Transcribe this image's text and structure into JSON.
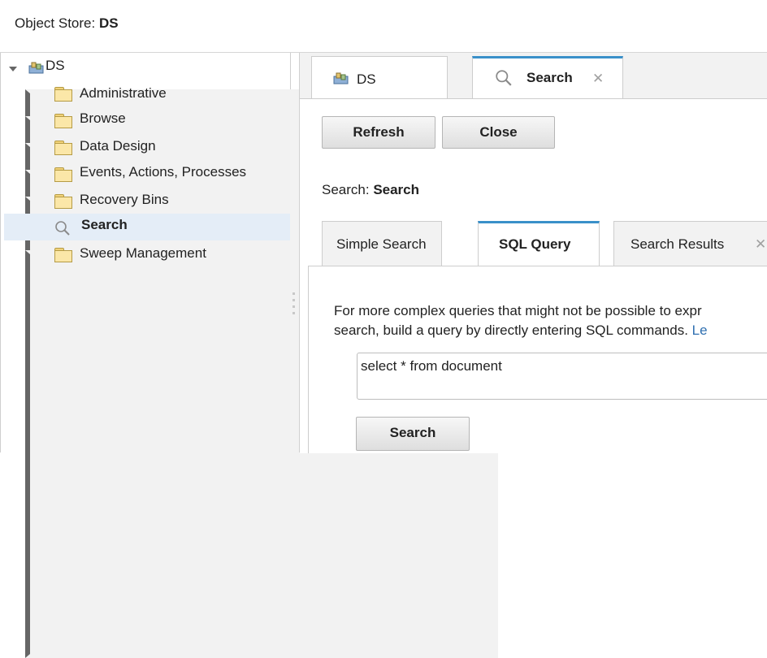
{
  "header": {
    "prefix": "Object Store: ",
    "store_name": "DS"
  },
  "tree": {
    "root_label": "DS",
    "items": [
      {
        "label": "Administrative",
        "icon": "folder-icon"
      },
      {
        "label": "Browse",
        "icon": "folder-icon"
      },
      {
        "label": "Data Design",
        "icon": "folder-icon"
      },
      {
        "label": "Events, Actions, Processes",
        "icon": "folder-icon"
      },
      {
        "label": "Recovery Bins",
        "icon": "folder-icon"
      },
      {
        "label": "Search",
        "icon": "search-icon",
        "selected": true
      },
      {
        "label": "Sweep Management",
        "icon": "folder-icon"
      }
    ]
  },
  "outer_tabs": [
    {
      "label": "DS",
      "icon": "object-store-icon"
    },
    {
      "label": "Search",
      "icon": "search-icon",
      "active": true,
      "closable": true
    }
  ],
  "toolbar": {
    "refresh_label": "Refresh",
    "close_label": "Close"
  },
  "search_title": {
    "prefix": "Search: ",
    "name": "Search"
  },
  "inner_tabs": [
    {
      "label": "Simple Search"
    },
    {
      "label": "SQL Query",
      "active": true
    },
    {
      "label": "Search Results",
      "closable": true
    }
  ],
  "sql": {
    "description_line1": "For more complex queries that might not be possible to expr",
    "description_line2": "search, build a query by directly entering SQL commands. ",
    "link_text": "Le",
    "query_value": "select * from document",
    "search_button": "Search"
  },
  "colors": {
    "accent": "#3a90c9",
    "selection": "#e4edf7",
    "link": "#2f6fb0"
  }
}
